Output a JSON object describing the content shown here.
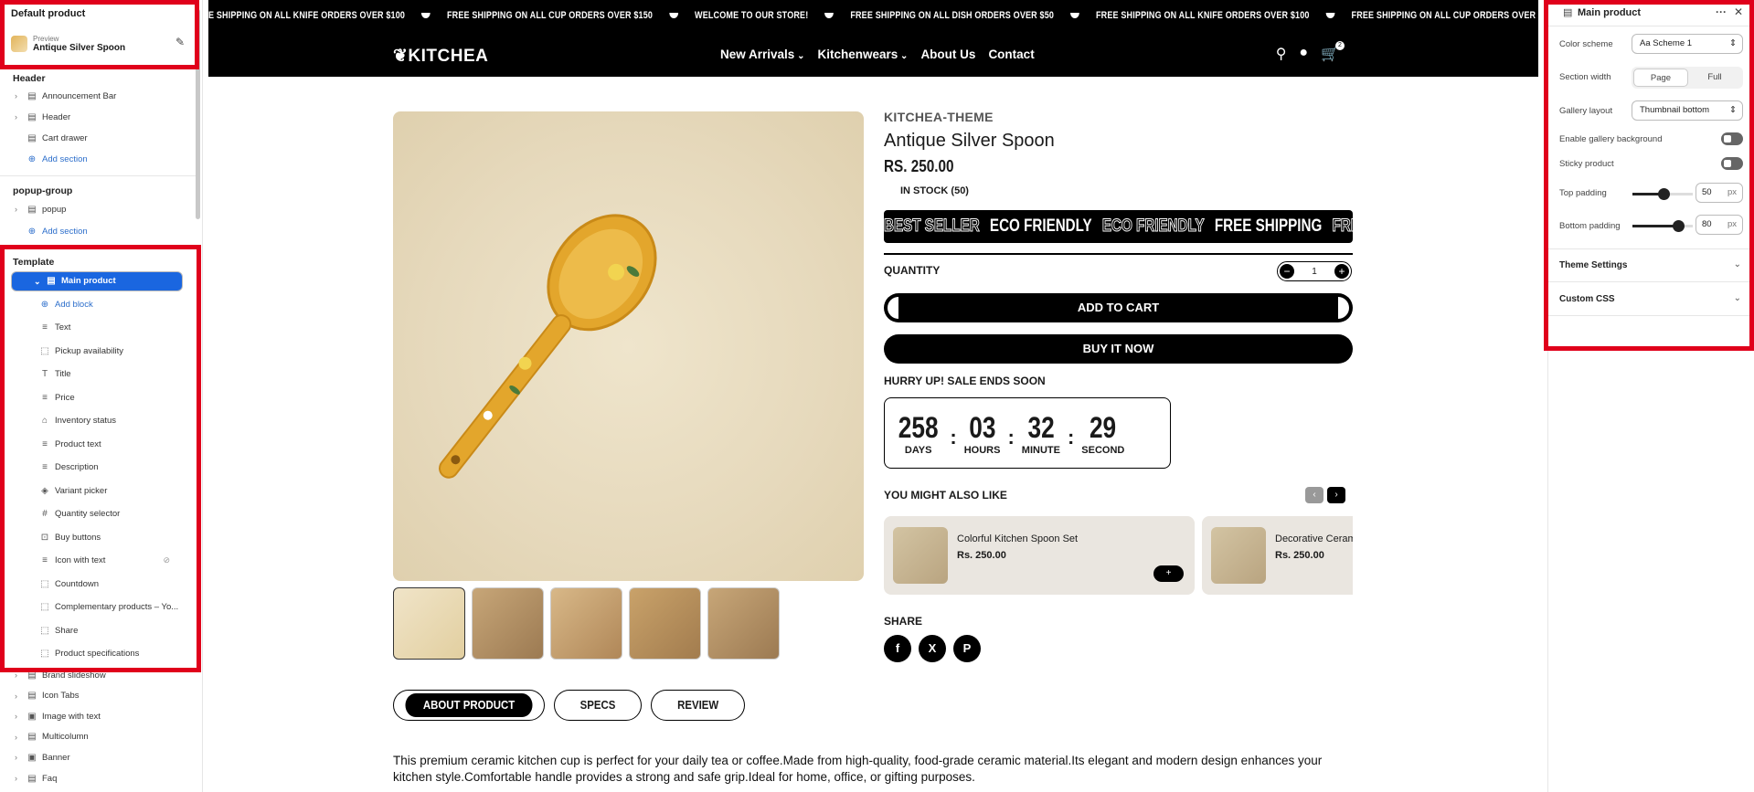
{
  "left_panel": {
    "title": "Default product",
    "preview_label": "Preview",
    "preview_value": "Antique Silver Spoon",
    "groups": [
      {
        "name": "Header",
        "items": [
          {
            "label": "Announcement Bar",
            "icon": "layout-icon",
            "chevron": true
          },
          {
            "label": "Header",
            "icon": "layout-icon",
            "chevron": true
          },
          {
            "label": "Cart drawer",
            "icon": "layout-icon",
            "chevron": false
          },
          {
            "label": "Add section",
            "icon": "plus-circle-icon",
            "add": true
          }
        ]
      },
      {
        "name": "popup-group",
        "items": [
          {
            "label": "popup",
            "icon": "layout-icon",
            "chevron": true
          },
          {
            "label": "Add section",
            "icon": "plus-circle-icon",
            "add": true
          }
        ]
      }
    ],
    "template_label": "Template",
    "main_product": "Main product",
    "blocks": [
      {
        "label": "Add block",
        "icon": "plus-circle-icon",
        "add": true
      },
      {
        "label": "Text",
        "icon": "text-icon"
      },
      {
        "label": "Pickup availability",
        "icon": "dashed-square-icon"
      },
      {
        "label": "Title",
        "icon": "title-icon"
      },
      {
        "label": "Price",
        "icon": "text-icon"
      },
      {
        "label": "Inventory status",
        "icon": "inventory-icon"
      },
      {
        "label": "Product text",
        "icon": "text-icon"
      },
      {
        "label": "Description",
        "icon": "text-icon"
      },
      {
        "label": "Variant picker",
        "icon": "variant-icon"
      },
      {
        "label": "Quantity selector",
        "icon": "hash-icon"
      },
      {
        "label": "Buy buttons",
        "icon": "buy-icon"
      },
      {
        "label": "Icon with text",
        "icon": "text-icon",
        "hidden": true
      },
      {
        "label": "Countdown",
        "icon": "dashed-square-icon"
      },
      {
        "label": "Complementary products – Yo...",
        "icon": "dashed-square-icon"
      },
      {
        "label": "Share",
        "icon": "dashed-square-icon"
      },
      {
        "label": "Product specifications",
        "icon": "dashed-square-icon"
      }
    ],
    "sections_after": [
      {
        "label": "Brand slideshow",
        "icon": "layout-icon"
      },
      {
        "label": "Icon Tabs",
        "icon": "layout-icon"
      },
      {
        "label": "Image with text",
        "icon": "image-icon"
      },
      {
        "label": "Multicolumn",
        "icon": "layout-icon"
      },
      {
        "label": "Banner",
        "icon": "image-icon"
      },
      {
        "label": "Faq",
        "icon": "layout-icon"
      }
    ]
  },
  "store": {
    "announcements": [
      "E SHIPPING ON ALL KNIFE ORDERS OVER $100",
      "FREE SHIPPING ON ALL CUP ORDERS OVER $150",
      "WELCOME TO OUR STORE!",
      "FREE SHIPPING ON ALL DISH ORDERS OVER $50",
      "FREE SHIPPING ON ALL KNIFE ORDERS OVER $100",
      "FREE SHIPPING ON ALL CUP ORDERS OVER $150"
    ],
    "logo": "KITCHEA",
    "nav": [
      "New Arrivals",
      "Kitchenwears",
      "About Us",
      "Contact"
    ],
    "cart_count": "2",
    "vendor": "KITCHEA-THEME",
    "product_title": "Antique Silver Spoon",
    "price": "RS. 250.00",
    "stock": "IN STOCK (50)",
    "badges": [
      {
        "text": "BEST SELLER",
        "outline": true
      },
      {
        "text": "ECO FRIENDLY",
        "outline": false
      },
      {
        "text": "ECO FRIENDLY",
        "outline": true
      },
      {
        "text": "FREE SHIPPING",
        "outline": false
      },
      {
        "text": "FRE",
        "outline": true
      }
    ],
    "quantity_label": "QUANTITY",
    "quantity_value": "1",
    "add_to_cart": "ADD TO CART",
    "buy_now": "BUY IT NOW",
    "hurry": "HURRY UP! SALE ENDS SOON",
    "countdown": [
      {
        "value": "258",
        "label": "DAYS"
      },
      {
        "value": "03",
        "label": "HOURS"
      },
      {
        "value": "32",
        "label": "MINUTE"
      },
      {
        "value": "29",
        "label": "SECOND"
      }
    ],
    "you_might_like": "YOU MIGHT ALSO LIKE",
    "recommendations": [
      {
        "name": "Colorful Kitchen Spoon Set",
        "price": "Rs. 250.00"
      },
      {
        "name": "Decorative Ceram",
        "price": "Rs. 250.00"
      }
    ],
    "share_label": "SHARE",
    "socials": [
      "f",
      "X",
      "P"
    ],
    "tabs": [
      "ABOUT PRODUCT",
      "SPECS",
      "REVIEW"
    ],
    "description": "This premium ceramic kitchen cup is perfect for your daily tea or coffee.Made from high-quality, food-grade ceramic material.Its elegant and modern design enhances your kitchen style.Comfortable handle provides a strong and safe grip.Ideal for home, office, or gifting purposes."
  },
  "right_panel": {
    "title": "Main product",
    "color_scheme_label": "Color scheme",
    "color_scheme_value": "Scheme 1",
    "section_width_label": "Section width",
    "section_width_options": [
      "Page",
      "Full"
    ],
    "section_width_selected": "Page",
    "gallery_layout_label": "Gallery layout",
    "gallery_layout_value": "Thumbnail bottom",
    "gallery_bg_label": "Enable gallery background",
    "sticky_label": "Sticky product",
    "top_padding_label": "Top padding",
    "top_padding_value": "50",
    "bottom_padding_label": "Bottom padding",
    "bottom_padding_value": "80",
    "unit": "px",
    "theme_settings": "Theme Settings",
    "custom_css": "Custom CSS"
  },
  "colors": {
    "highlight": "#e0001b",
    "selected": "#1a66e0",
    "store_bg": "#000000"
  }
}
